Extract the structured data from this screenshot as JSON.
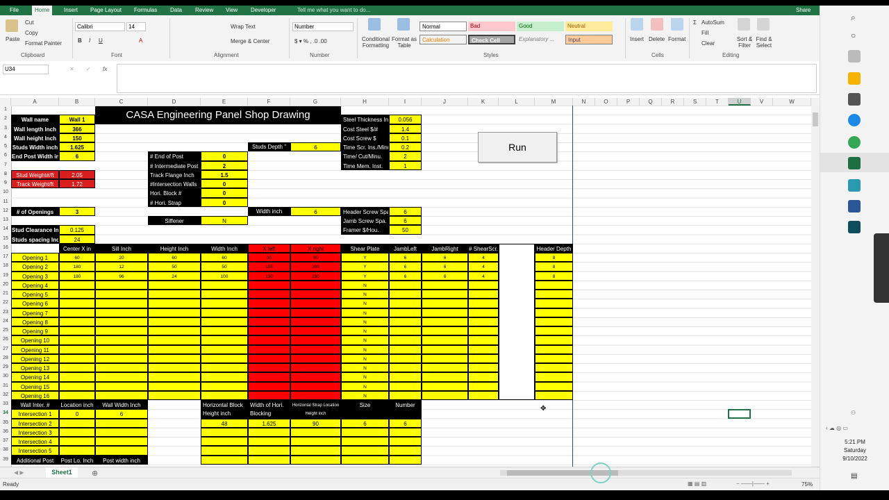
{
  "ribbon": {
    "tabs": [
      "File",
      "Home",
      "Insert",
      "Page Layout",
      "Formulas",
      "Data",
      "Review",
      "View",
      "Developer"
    ],
    "tell_me": "Tell me what you want to do...",
    "share": "Share",
    "clipboard": {
      "paste": "Paste",
      "cut": "Cut",
      "copy": "Copy",
      "format_painter": "Format Painter",
      "group": "Clipboard"
    },
    "font": {
      "name": "Calibri",
      "size": "14",
      "group": "Font"
    },
    "alignment": {
      "wrap": "Wrap Text",
      "merge": "Merge & Center",
      "group": "Alignment"
    },
    "number": {
      "format": "Number",
      "group": "Number"
    },
    "styles": {
      "cond": "Conditional Formatting",
      "table": "Format as Table",
      "normal": "Normal",
      "bad": "Bad",
      "good": "Good",
      "neutral": "Neutral",
      "calculation": "Calculation",
      "check": "Check Cell",
      "explanatory": "Explanatory ...",
      "input": "Input",
      "group": "Styles"
    },
    "cells": {
      "insert": "Insert",
      "delete": "Delete",
      "format": "Format",
      "group": "Cells"
    },
    "editing": {
      "autosum": "AutoSum",
      "fill": "Fill",
      "clear": "Clear",
      "sort": "Sort & Filter",
      "find": "Find & Select",
      "group": "Editing"
    }
  },
  "namebox": "U34",
  "formula_icons": {
    "cancel": "✕",
    "enter": "✓",
    "fx": "fx"
  },
  "columns": [
    "A",
    "B",
    "C",
    "D",
    "E",
    "F",
    "G",
    "H",
    "I",
    "J",
    "K",
    "L",
    "M",
    "N",
    "O",
    "P",
    "Q",
    "R",
    "S",
    "T",
    "U",
    "V",
    "W"
  ],
  "title": "CASA Engineering Panel Shop Drawing",
  "left_params": [
    {
      "label": "Wall name",
      "value": "Wall 1"
    },
    {
      "label": "Wall length Inch",
      "value": "366"
    },
    {
      "label": "Wall height Inch",
      "value": "150"
    },
    {
      "label": "Studs Width inch",
      "value": "1.625"
    },
    {
      "label": "End Post Width in",
      "value": "6"
    }
  ],
  "weights": [
    {
      "label": "Stud Weight#/ft",
      "value": "2.05"
    },
    {
      "label": "Track Weight/ft",
      "value": "1.72"
    }
  ],
  "openings_count": {
    "label": "# of Openings",
    "value": "3"
  },
  "clearance": [
    {
      "label": "Stud Clearance Inch",
      "value": "0.125"
    },
    {
      "label": "Studs spacing Inch",
      "value": "24"
    }
  ],
  "mid_params": [
    {
      "label": "# End of Post",
      "value": "0"
    },
    {
      "label": "# Intermediate Post",
      "value": "2"
    },
    {
      "label": "Track Flange Inch",
      "value": "1.5"
    },
    {
      "label": "#Intersection Walls",
      "value": "0"
    },
    {
      "label": "Hori. Block #",
      "value": "0"
    },
    {
      "label": "# Hori. Strap",
      "value": "0"
    }
  ],
  "siffener": {
    "label": "Siffener",
    "value": "N"
  },
  "studs_depth": {
    "label": "Studs Depth \"",
    "value": "6"
  },
  "width_inch": {
    "label": "Width inch",
    "value": "6"
  },
  "cost_params": [
    {
      "label": "Steel Thickness In",
      "value": "0.056"
    },
    {
      "label": "Cost Steel $/#",
      "value": "1.4"
    },
    {
      "label": "Cost Screw $",
      "value": "0.1"
    },
    {
      "label": "Time Scr. Ins./Minu",
      "value": "0.2"
    },
    {
      "label": "Time/ Cut/Minu.",
      "value": "2"
    },
    {
      "label": "Time Mem. Inst.",
      "value": "1"
    }
  ],
  "screw_params": [
    {
      "label": "Header Screw Spa.",
      "value": "6"
    },
    {
      "label": "Jamb Screw Spa.",
      "value": "6"
    },
    {
      "label": "Framer $/Hou.",
      "value": "50"
    }
  ],
  "run_button": "Run",
  "openings_table": {
    "headers": [
      "Center X in",
      "Sill Inch",
      "Height  Inch",
      "Width Inch",
      "X left",
      "X right",
      "Shear Plate",
      "JambLeft",
      "JambRight",
      "# ShearScr.",
      "",
      "Header Depth"
    ],
    "rows": [
      {
        "name": "Opening 1",
        "cx": "60",
        "sill": "20",
        "h": "60",
        "w": "60",
        "xl": "30",
        "xr": "90",
        "sp": "Y",
        "jl": "6",
        "jr": "6",
        "ss": "4",
        "hd": "8"
      },
      {
        "name": "Opening 2",
        "cx": "180",
        "sill": "12",
        "h": "50",
        "w": "50",
        "xl": "155",
        "xr": "205",
        "sp": "Y",
        "jl": "6",
        "jr": "6",
        "ss": "4",
        "hd": "8"
      },
      {
        "name": "Opening 3",
        "cx": "180",
        "sill": "96",
        "h": "24",
        "w": "100",
        "xl": "130",
        "xr": "230",
        "sp": "Y",
        "jl": "6",
        "jr": "6",
        "ss": "4",
        "hd": "8"
      },
      {
        "name": "Opening 4",
        "sp": "N"
      },
      {
        "name": "Opening 5",
        "sp": "N"
      },
      {
        "name": "Opening 6",
        "sp": "N"
      },
      {
        "name": "Opening 7",
        "sp": "N"
      },
      {
        "name": "Opening 8",
        "sp": "N"
      },
      {
        "name": "Opening 9",
        "sp": "N"
      },
      {
        "name": "Opening 10",
        "sp": "N"
      },
      {
        "name": "Opening 11",
        "sp": "N"
      },
      {
        "name": "Opening 12",
        "sp": "N"
      },
      {
        "name": "Opening 13",
        "sp": "N"
      },
      {
        "name": "Opening 14",
        "sp": "N"
      },
      {
        "name": "Opening 15",
        "sp": "N"
      },
      {
        "name": "Opening 16",
        "sp": "N"
      }
    ]
  },
  "intersection_table": {
    "headers": [
      "Wall Inter. #",
      "Location inch",
      "Wall Width Inch"
    ],
    "rows": [
      {
        "name": "Intersection 1",
        "loc": "0",
        "w": "6"
      },
      {
        "name": "Intersection 2"
      },
      {
        "name": "Intersection 3"
      },
      {
        "name": "Intersection 4"
      },
      {
        "name": "Intersection 5"
      }
    ],
    "additional": [
      "Additional Post",
      "Post Lo. Inch",
      "Post width inch"
    ]
  },
  "block_table": {
    "headers": [
      "Horizontal Block Height inch",
      "Width of Hori. Blocking",
      "Horizontal Strap Location Height inch",
      "Size",
      "Number"
    ],
    "values": [
      "48",
      "1.625",
      "90",
      "6",
      "6"
    ]
  },
  "sheet_tab": "Sheet1",
  "status": {
    "ready": "Ready",
    "zoom": "75%"
  },
  "clock": {
    "time": "5:21 PM",
    "day": "Saturday",
    "date": "9/10/2022"
  }
}
